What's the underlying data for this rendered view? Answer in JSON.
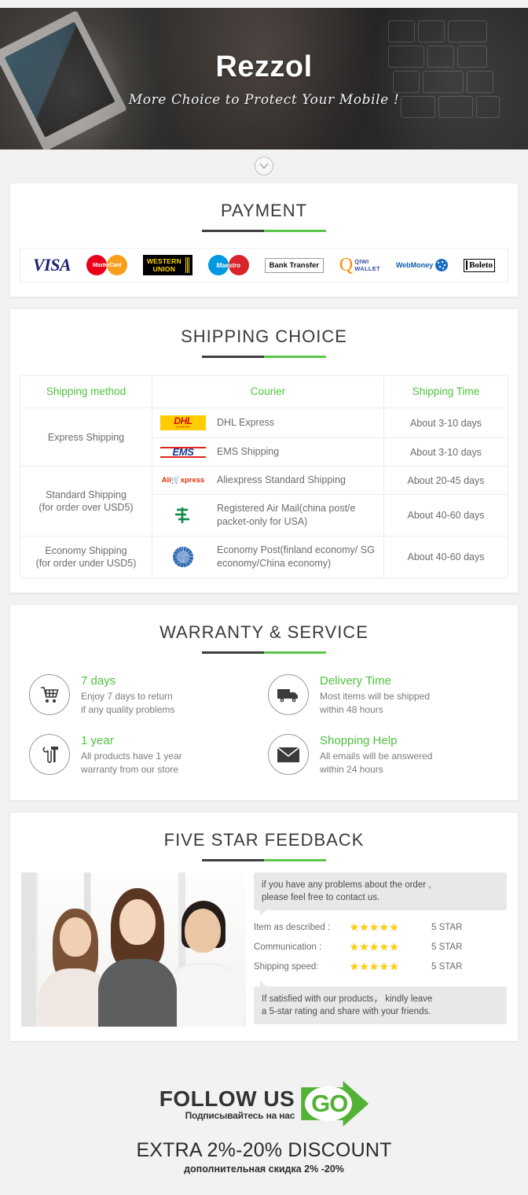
{
  "hero": {
    "brand": "Rezzol",
    "tagline": "More Choice to Protect Your Mobile !"
  },
  "chevron": {
    "icon": "chevron-down-icon"
  },
  "payment": {
    "title": "PAYMENT",
    "methods": [
      {
        "name": "VISA",
        "icon": "visa-icon"
      },
      {
        "name": "MasterCard",
        "icon": "mastercard-icon"
      },
      {
        "name": "WESTERN UNION",
        "line1": "WESTERN",
        "line2": "UNION",
        "icon": "western-union-icon"
      },
      {
        "name": "Maestro",
        "icon": "maestro-icon"
      },
      {
        "name": "Bank Transfer",
        "icon": "bank-transfer-icon"
      },
      {
        "name": "QIWI WALLET",
        "line1": "QIWI",
        "line2": "WALLET",
        "icon": "qiwi-wallet-icon"
      },
      {
        "name": "WebMoney",
        "icon": "webmoney-icon"
      },
      {
        "name": "Boleto",
        "icon": "boleto-icon"
      }
    ]
  },
  "shipping": {
    "title": "SHIPPING CHOICE",
    "columns": [
      "Shipping method",
      "Courier",
      "Shipping Time"
    ],
    "rows": [
      {
        "method": "Express Shipping",
        "method_sub": "",
        "couriers": [
          {
            "logo": "dhl-icon",
            "logo_text": "DHL",
            "logo_sub": "EXPRESS",
            "name": "DHL Express",
            "time": "About 3-10 days"
          },
          {
            "logo": "ems-icon",
            "logo_text": "EMS",
            "logo_sub": "",
            "name": "EMS Shipping",
            "time": "About 3-10 days"
          }
        ]
      },
      {
        "method": "Standard Shipping",
        "method_sub": "(for order over USD5)",
        "couriers": [
          {
            "logo": "aliexpress-icon",
            "logo_text": "AliExpress",
            "logo_sub": "",
            "name": "Aliexpress Standard Shipping",
            "time": "About 20-45 days"
          },
          {
            "logo": "china-post-icon",
            "logo_text": "China Post",
            "logo_sub": "",
            "name": "Registered Air Mail(china post/e packet-only for USA)",
            "time": "About 40-60 days"
          }
        ]
      },
      {
        "method": "Economy Shipping",
        "method_sub": "(for order under USD5)",
        "couriers": [
          {
            "logo": "un-post-icon",
            "logo_text": "UN",
            "logo_sub": "",
            "name": "Economy Post(finland economy/ SG economy/China economy)",
            "time": "About 40-60 days"
          }
        ]
      }
    ]
  },
  "warranty": {
    "title": "WARRANTY & SERVICE",
    "items": [
      {
        "icon": "shopping-cart-icon",
        "head": "7 days",
        "line1": "Enjoy 7 days to return",
        "line2": "if any quality problems"
      },
      {
        "icon": "delivery-truck-icon",
        "head": "Delivery Time",
        "line1": "Most items will be shipped",
        "line2": "within 48 hours"
      },
      {
        "icon": "tools-icon",
        "head": "1 year",
        "line1": "All products have 1 year",
        "line2": "warranty from our store"
      },
      {
        "icon": "envelope-icon",
        "head": "Shopping Help",
        "line1": "All emails will be answered",
        "line2": "within 24 hours"
      }
    ]
  },
  "feedback": {
    "title": "FIVE STAR FEEDBACK",
    "photo_alt": "three-smiling-business-people",
    "bubble_top_line1": "if you have any problems about the order ,",
    "bubble_top_line2": "please feel free to contact us.",
    "ratings": [
      {
        "label": "Item as described :",
        "stars": "★★★★★",
        "star_count": 5,
        "value": "5 STAR"
      },
      {
        "label": "Communication :",
        "stars": "★★★★★",
        "star_count": 5,
        "value": "5 STAR"
      },
      {
        "label": "Shipping speed:",
        "stars": "★★★★★",
        "star_count": 5,
        "value": "5 STAR"
      }
    ],
    "bubble_bottom_line1": "If satisfied with our products， kindly leave",
    "bubble_bottom_line2": "a 5-star rating and share with your friends."
  },
  "footer": {
    "follow_en": "FOLLOW US",
    "follow_ru": "Подписывайтесь на нас",
    "go_badge": "GO",
    "discount_en": "EXTRA 2%-20% DISCOUNT",
    "discount_ru": "дополнительная скидка 2% -20%"
  },
  "colors": {
    "green": "#4fc23e",
    "go_green": "#53b135",
    "dark_rule": "#3f3f43",
    "hero_bg": "#2e2c2b",
    "page_bg": "#f2f2f2",
    "star_yellow": "#ffd10a"
  }
}
